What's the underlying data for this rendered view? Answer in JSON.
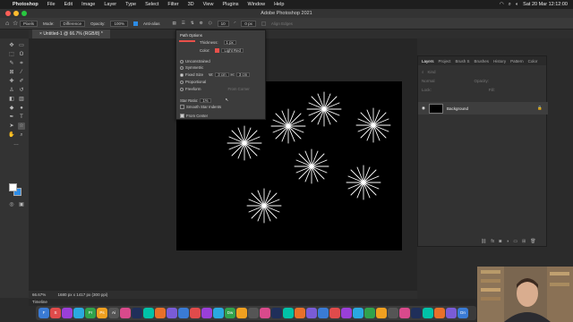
{
  "menubar": {
    "apple_glyph": "",
    "items": [
      "Photoshop",
      "File",
      "Edit",
      "Image",
      "Layer",
      "Type",
      "Select",
      "Filter",
      "3D",
      "View",
      "Plugins",
      "Window",
      "Help"
    ],
    "clock": "Sat 20 Mar  12:12:00"
  },
  "window": {
    "title": "Adobe Photoshop 2021"
  },
  "options_bar": {
    "fill_label": "Pixels",
    "mode_label": "Mode:",
    "mode_value": "Difference",
    "opacity_label": "Opacity:",
    "opacity_value": "100%",
    "antialias_label": "Anti-alias",
    "sides_value": "10",
    "radius_value": "0 px",
    "align_edges_label": "Align Edges"
  },
  "document_tab": {
    "label": "Untitled-1 @ 66.7% (RGB/8) *"
  },
  "path_options": {
    "title": "Path Options",
    "thickness_label": "Thickness:",
    "thickness_value": "1 px",
    "color_label": "Color:",
    "color_value": "Light Red",
    "unconstrained": "Unconstrained",
    "symmetric": "Symmetric",
    "fixed_size": "Fixed Size",
    "w_label": "W:",
    "w_value": "3 cm",
    "h_label": "H:",
    "h_value": "3 cm",
    "proportional": "Proportional",
    "freeform": "Freeform",
    "from_corner": "From Corner",
    "star_ratio_label": "Star Ratio:",
    "star_ratio_value": "1%",
    "smooth_indents": "Smooth Star Indents",
    "from_center": "From Center"
  },
  "layers_panel": {
    "tabs": [
      "Layers",
      "Project",
      "Brush S",
      "Brushes",
      "History",
      "Pattern",
      "Color"
    ],
    "kind_label": "Kind",
    "mode_label": "Normal",
    "opacity_label": "Opacity:",
    "lock_label": "Lock:",
    "fill_label": "Fill:",
    "layer_name": "Background"
  },
  "statusbar": {
    "zoom": "66.67%",
    "doc_size": "1680 px x 1417 px (300 ppi)"
  },
  "timeline": {
    "label": "Timeline"
  },
  "dock": {
    "apps": [
      "F",
      "S",
      "",
      "",
      "Pr",
      "Ps",
      "Ai",
      "",
      "",
      "",
      "",
      "",
      "",
      "",
      "",
      "",
      "Dw",
      "",
      "",
      "",
      "",
      "",
      "",
      "",
      "",
      "",
      "",
      "",
      "",
      "",
      "",
      "",
      "",
      "",
      "",
      "",
      "Dn"
    ]
  },
  "colors": {
    "accent": "#2d8ce6",
    "light_red": "#e8504a",
    "close": "#ff5f57",
    "minimize": "#febc2e",
    "zoom": "#28c840"
  }
}
